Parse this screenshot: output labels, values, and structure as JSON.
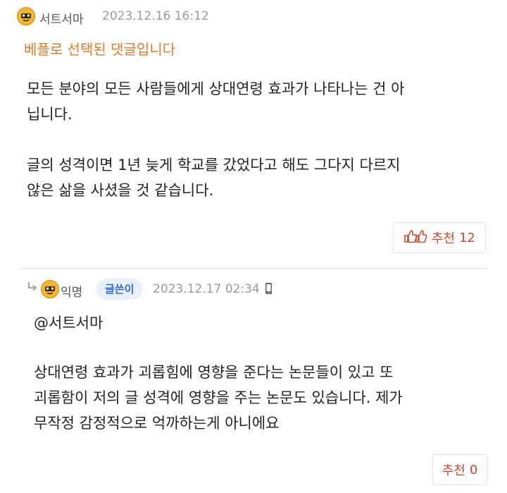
{
  "comment": {
    "author": "서트서마",
    "timestamp": "2023.12.16 16:12",
    "best_label": "베플로 선택된 댓글입니다",
    "body": "모든 분야의 모든 사람들에게 상대연령 효과가 나타나는 건 아\n닙니다.\n\n글의 성격이면 1년 늦게 학교를 갔었다고 해도 그다지 다르지\n않은 삶을 사셨을 것 같습니다.",
    "recommend": {
      "label": "추천",
      "count": "12"
    }
  },
  "reply": {
    "author": "익명",
    "badge": "글쓴이",
    "timestamp": "2023.12.17 02:34",
    "mention": "@서트서마",
    "body": "상대연령 효과가 괴롭힘에 영향을 준다는 논문들이 있고 또\n괴롭함이 저의 글 성격에 영향을 주는 논문도 있습니다. 제가\n무작정 감정적으로 억까하는게 아니에요",
    "recommend": {
      "label": "추천",
      "count": "0"
    }
  },
  "icons": {
    "avatar": "emoticon-face-icon",
    "reply_arrow": "reply-arrow-icon",
    "mobile": "mobile-phone-icon",
    "thumbs": "thumbs-up-icon"
  },
  "colors": {
    "best_label": "#e0792a",
    "recommend": "#d24a2e",
    "badge_bg": "#e8f0fc",
    "badge_text": "#2e6cc7"
  }
}
